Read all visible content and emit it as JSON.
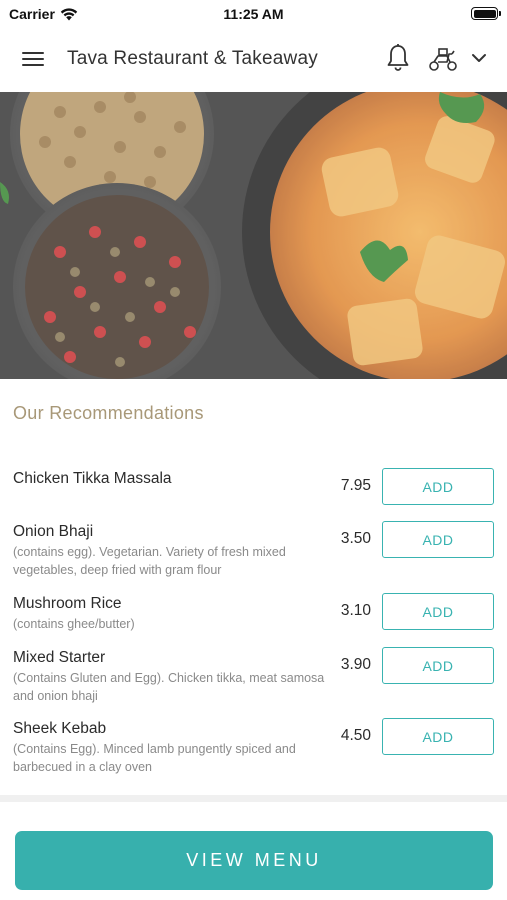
{
  "status_bar": {
    "carrier": "Carrier",
    "time": "11:25 AM"
  },
  "header": {
    "title": "Tava Restaurant & Takeaway",
    "icons": [
      "hamburger-menu-icon",
      "bell-icon",
      "scooter-icon",
      "chevron-down-icon"
    ]
  },
  "hero": {
    "image": "spices-and-chicken-curry-photo"
  },
  "recommendations": {
    "title": "Our Recommendations",
    "add_label": "ADD",
    "items": [
      {
        "name": "Chicken Tikka Massala",
        "description": "",
        "price": "7.95"
      },
      {
        "name": "Onion Bhaji",
        "description": "(contains egg). Vegetarian. Variety of fresh mixed vegetables, deep fried with gram flour",
        "price": "3.50"
      },
      {
        "name": "Mushroom Rice",
        "description": "(contains ghee/butter)",
        "price": "3.10"
      },
      {
        "name": "Mixed Starter",
        "description": "(Contains Gluten and Egg). Chicken tikka, meat samosa and onion bhaji",
        "price": "3.90"
      },
      {
        "name": "Sheek Kebab",
        "description": "(Contains Egg). Minced lamb pungently spiced and barbecued in a clay oven",
        "price": "4.50"
      }
    ]
  },
  "footer": {
    "view_menu_label": "VIEW MENU"
  },
  "colors": {
    "accent": "#37b0ad",
    "section_title": "#a89878",
    "description": "#8a8a8a"
  }
}
